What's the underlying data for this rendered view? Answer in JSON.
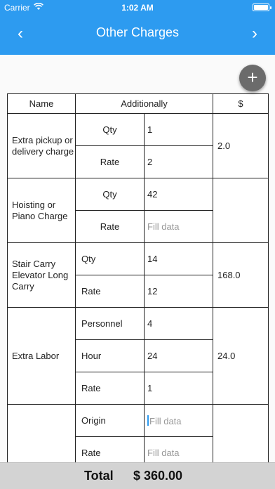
{
  "status_bar": {
    "carrier": "Carrier",
    "time": "1:02 AM"
  },
  "nav": {
    "title": "Other Charges",
    "back_icon": "‹",
    "forward_icon": "›"
  },
  "fab": {
    "icon": "+"
  },
  "table": {
    "headers": {
      "name": "Name",
      "additionally": "Additionally",
      "amount": "$"
    },
    "sections": [
      {
        "name": "Extra pickup or delivery charge",
        "total": "2.0",
        "rows": [
          {
            "label": "Qty",
            "value": "1",
            "placeholder": ""
          },
          {
            "label": "Rate",
            "value": "2",
            "placeholder": ""
          }
        ]
      },
      {
        "name": "Hoisting or Piano Charge",
        "total": "",
        "rows": [
          {
            "label": "Qty",
            "value": "42",
            "placeholder": ""
          },
          {
            "label": "Rate",
            "value": "",
            "placeholder": "Fill data"
          }
        ]
      },
      {
        "name": "Stair Carry Elevator Long Carry",
        "total": "168.0",
        "rows": [
          {
            "label": "Qty",
            "value": "14",
            "placeholder": ""
          },
          {
            "label": "Rate",
            "value": "12",
            "placeholder": ""
          }
        ]
      },
      {
        "name": "Extra Labor",
        "total": "24.0",
        "rows": [
          {
            "label": "Personnel",
            "value": "4",
            "placeholder": ""
          },
          {
            "label": "Hour",
            "value": "24",
            "placeholder": ""
          },
          {
            "label": "Rate",
            "value": "1",
            "placeholder": ""
          }
        ]
      },
      {
        "name": "",
        "total": "",
        "rows": [
          {
            "label": "Origin",
            "value": "",
            "placeholder": "Fill data"
          },
          {
            "label": "Rate",
            "value": "",
            "placeholder": "Fill data"
          }
        ]
      }
    ]
  },
  "footer": {
    "total_label": "Total",
    "total_value": "$ 360.00"
  },
  "colors": {
    "accent": "#2d9bf0",
    "footer_bg": "#d3d3d3",
    "fab_bg": "#6b6b6b",
    "placeholder": "#9a9a9a"
  }
}
